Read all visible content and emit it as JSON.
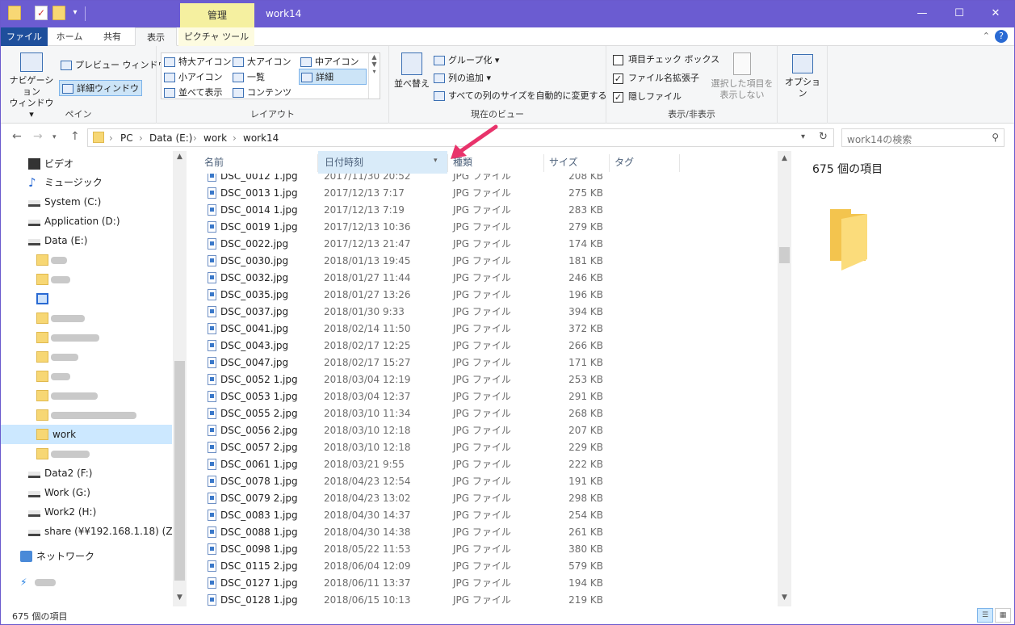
{
  "title": {
    "context_tab": "管理",
    "window_title": "work14",
    "min": "—",
    "max": "☐",
    "close": "✕"
  },
  "tabs": [
    {
      "label": "ファイル"
    },
    {
      "label": "ホーム"
    },
    {
      "label": "共有"
    },
    {
      "label": "表示"
    },
    {
      "label": "ピクチャ ツール"
    }
  ],
  "ribbon": {
    "pane": {
      "nav_pane": "ナビゲーション\nウィンドウ ▾",
      "preview": "プレビュー ウィンドウ",
      "details": "詳細ウィンドウ",
      "label": "ペイン"
    },
    "layout": {
      "items": [
        "特大アイコン",
        "大アイコン",
        "中アイコン",
        "小アイコン",
        "一覧",
        "詳細",
        "並べて表示",
        "コンテンツ"
      ],
      "label": "レイアウト"
    },
    "view": {
      "sort": "並べ替え",
      "group": "グループ化 ▾",
      "add_col": "列の追加 ▾",
      "fit": "すべての列のサイズを自動的に変更する",
      "label": "現在のビュー"
    },
    "show": {
      "item_cb": "項目チェック ボックス",
      "ext": "ファイル名拡張子",
      "hidden": "隠しファイル",
      "hide_sel": "選択した項目を\n表示しない",
      "label": "表示/非表示"
    },
    "options": "オプション"
  },
  "address": {
    "crumbs": [
      "PC",
      "Data (E:)",
      "work",
      "work14"
    ],
    "search_placeholder": "work14の検索"
  },
  "nav": [
    {
      "label": "ビデオ",
      "icon": "video-icon"
    },
    {
      "label": "ミュージック",
      "icon": "music-icon"
    },
    {
      "label": "System (C:)",
      "icon": "drive-icon"
    },
    {
      "label": "Application (D:)",
      "icon": "drive-icon"
    },
    {
      "label": "Data (E:)",
      "icon": "drive-icon"
    },
    {
      "label": "",
      "icon": "folder-icon"
    },
    {
      "label": "",
      "icon": "folder-icon"
    },
    {
      "label": "",
      "icon": "image-folder-icon"
    },
    {
      "label": "",
      "icon": "folder-icon"
    },
    {
      "label": "",
      "icon": "folder-icon"
    },
    {
      "label": "",
      "icon": "folder-icon"
    },
    {
      "label": "",
      "icon": "folder-icon"
    },
    {
      "label": "",
      "icon": "folder-icon"
    },
    {
      "label": "",
      "icon": "folder-icon"
    },
    {
      "label": "work",
      "icon": "folder-icon",
      "selected": true
    },
    {
      "label": "",
      "icon": "folder-icon"
    },
    {
      "label": "Data2 (F:)",
      "icon": "drive-icon"
    },
    {
      "label": "Work (G:)",
      "icon": "drive-icon"
    },
    {
      "label": "Work2 (H:)",
      "icon": "drive-icon"
    },
    {
      "label": "share (¥¥192.168.1.18) (Z:)",
      "icon": "network-drive-icon"
    },
    {
      "label": "ネットワーク",
      "icon": "network-icon"
    },
    {
      "label": "",
      "icon": "onedrive-icon"
    }
  ],
  "columns": [
    "名前",
    "日付時刻",
    "種類",
    "サイズ",
    "タグ"
  ],
  "files": [
    [
      "DSC_0012 1.jpg",
      "2017/11/30 20:52",
      "JPG ファイル",
      "208 KB"
    ],
    [
      "DSC_0013 1.jpg",
      "2017/12/13 7:17",
      "JPG ファイル",
      "275 KB"
    ],
    [
      "DSC_0014 1.jpg",
      "2017/12/13 7:19",
      "JPG ファイル",
      "283 KB"
    ],
    [
      "DSC_0019 1.jpg",
      "2017/12/13 10:36",
      "JPG ファイル",
      "279 KB"
    ],
    [
      "DSC_0022.jpg",
      "2017/12/13 21:47",
      "JPG ファイル",
      "174 KB"
    ],
    [
      "DSC_0030.jpg",
      "2018/01/13 19:45",
      "JPG ファイル",
      "181 KB"
    ],
    [
      "DSC_0032.jpg",
      "2018/01/27 11:44",
      "JPG ファイル",
      "246 KB"
    ],
    [
      "DSC_0035.jpg",
      "2018/01/27 13:26",
      "JPG ファイル",
      "196 KB"
    ],
    [
      "DSC_0037.jpg",
      "2018/01/30 9:33",
      "JPG ファイル",
      "394 KB"
    ],
    [
      "DSC_0041.jpg",
      "2018/02/14 11:50",
      "JPG ファイル",
      "372 KB"
    ],
    [
      "DSC_0043.jpg",
      "2018/02/17 12:25",
      "JPG ファイル",
      "266 KB"
    ],
    [
      "DSC_0047.jpg",
      "2018/02/17 15:27",
      "JPG ファイル",
      "171 KB"
    ],
    [
      "DSC_0052 1.jpg",
      "2018/03/04 12:19",
      "JPG ファイル",
      "253 KB"
    ],
    [
      "DSC_0053 1.jpg",
      "2018/03/04 12:37",
      "JPG ファイル",
      "291 KB"
    ],
    [
      "DSC_0055 2.jpg",
      "2018/03/10 11:34",
      "JPG ファイル",
      "268 KB"
    ],
    [
      "DSC_0056 2.jpg",
      "2018/03/10 12:18",
      "JPG ファイル",
      "207 KB"
    ],
    [
      "DSC_0057 2.jpg",
      "2018/03/10 12:18",
      "JPG ファイル",
      "229 KB"
    ],
    [
      "DSC_0061 1.jpg",
      "2018/03/21 9:55",
      "JPG ファイル",
      "222 KB"
    ],
    [
      "DSC_0078 1.jpg",
      "2018/04/23 12:54",
      "JPG ファイル",
      "191 KB"
    ],
    [
      "DSC_0079 2.jpg",
      "2018/04/23 13:02",
      "JPG ファイル",
      "298 KB"
    ],
    [
      "DSC_0083 1.jpg",
      "2018/04/30 14:37",
      "JPG ファイル",
      "254 KB"
    ],
    [
      "DSC_0088 1.jpg",
      "2018/04/30 14:38",
      "JPG ファイル",
      "261 KB"
    ],
    [
      "DSC_0098 1.jpg",
      "2018/05/22 11:53",
      "JPG ファイル",
      "380 KB"
    ],
    [
      "DSC_0115 2.jpg",
      "2018/06/04 12:09",
      "JPG ファイル",
      "579 KB"
    ],
    [
      "DSC_0127 1.jpg",
      "2018/06/11 13:37",
      "JPG ファイル",
      "194 KB"
    ],
    [
      "DSC_0128 1.jpg",
      "2018/06/15 10:13",
      "JPG ファイル",
      "219 KB"
    ]
  ],
  "preview": {
    "count": "675 個の項目"
  },
  "status": {
    "text": "675 個の項目"
  },
  "colors": {
    "titlebar": "#6b5cd1",
    "file_tab": "#1e4f9c",
    "selection": "#cce8ff",
    "arrow": "#e8336b"
  }
}
